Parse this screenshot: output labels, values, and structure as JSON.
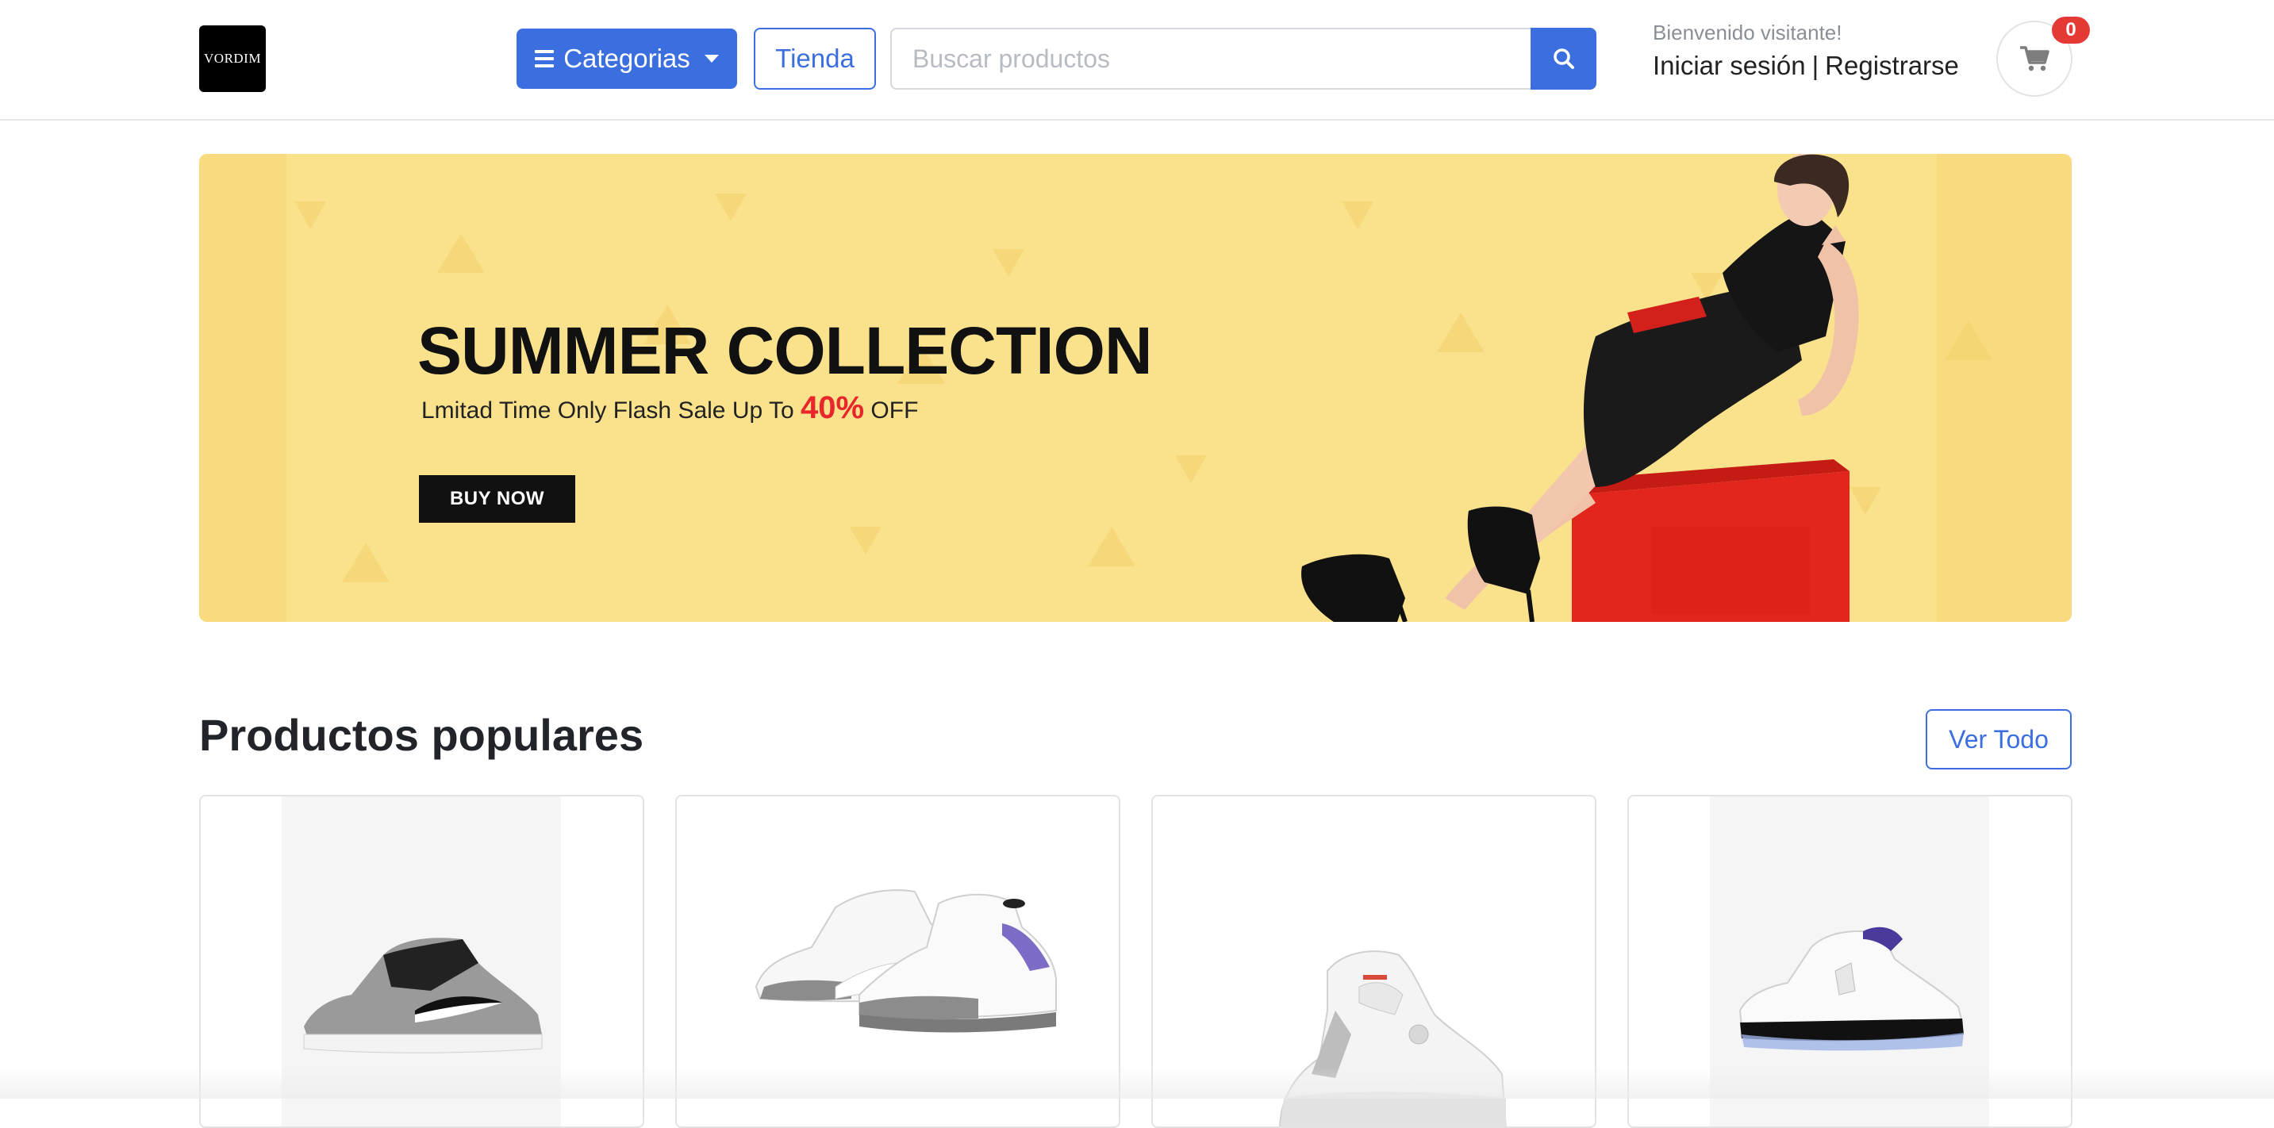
{
  "header": {
    "logo_text": "VORDIM",
    "categories_label": "Categorias",
    "shop_label": "Tienda",
    "search_placeholder": "Buscar productos",
    "welcome_text": "Bienvenido visitante!",
    "login_label": "Iniciar sesión",
    "separator": "|",
    "register_label": "Registrarse",
    "cart_count": "0"
  },
  "banner": {
    "title": "SUMMER COLLECTION",
    "subtitle_prefix": "Lmitad Time Only Flash Sale Up To",
    "discount": "40%",
    "subtitle_suffix": "OFF",
    "cta_label": "BUY NOW"
  },
  "products": {
    "section_title": "Productos populares",
    "view_all_label": "Ver Todo",
    "items": [
      {
        "icon": "sneaker-gray-black"
      },
      {
        "icon": "sneaker-white-purple"
      },
      {
        "icon": "sneaker-white-gray"
      },
      {
        "icon": "sneaker-white-black"
      }
    ]
  },
  "colors": {
    "primary": "#3b6fe0",
    "banner_bg": "#fae28d",
    "badge": "#e53935",
    "discount": "#e8262b"
  }
}
